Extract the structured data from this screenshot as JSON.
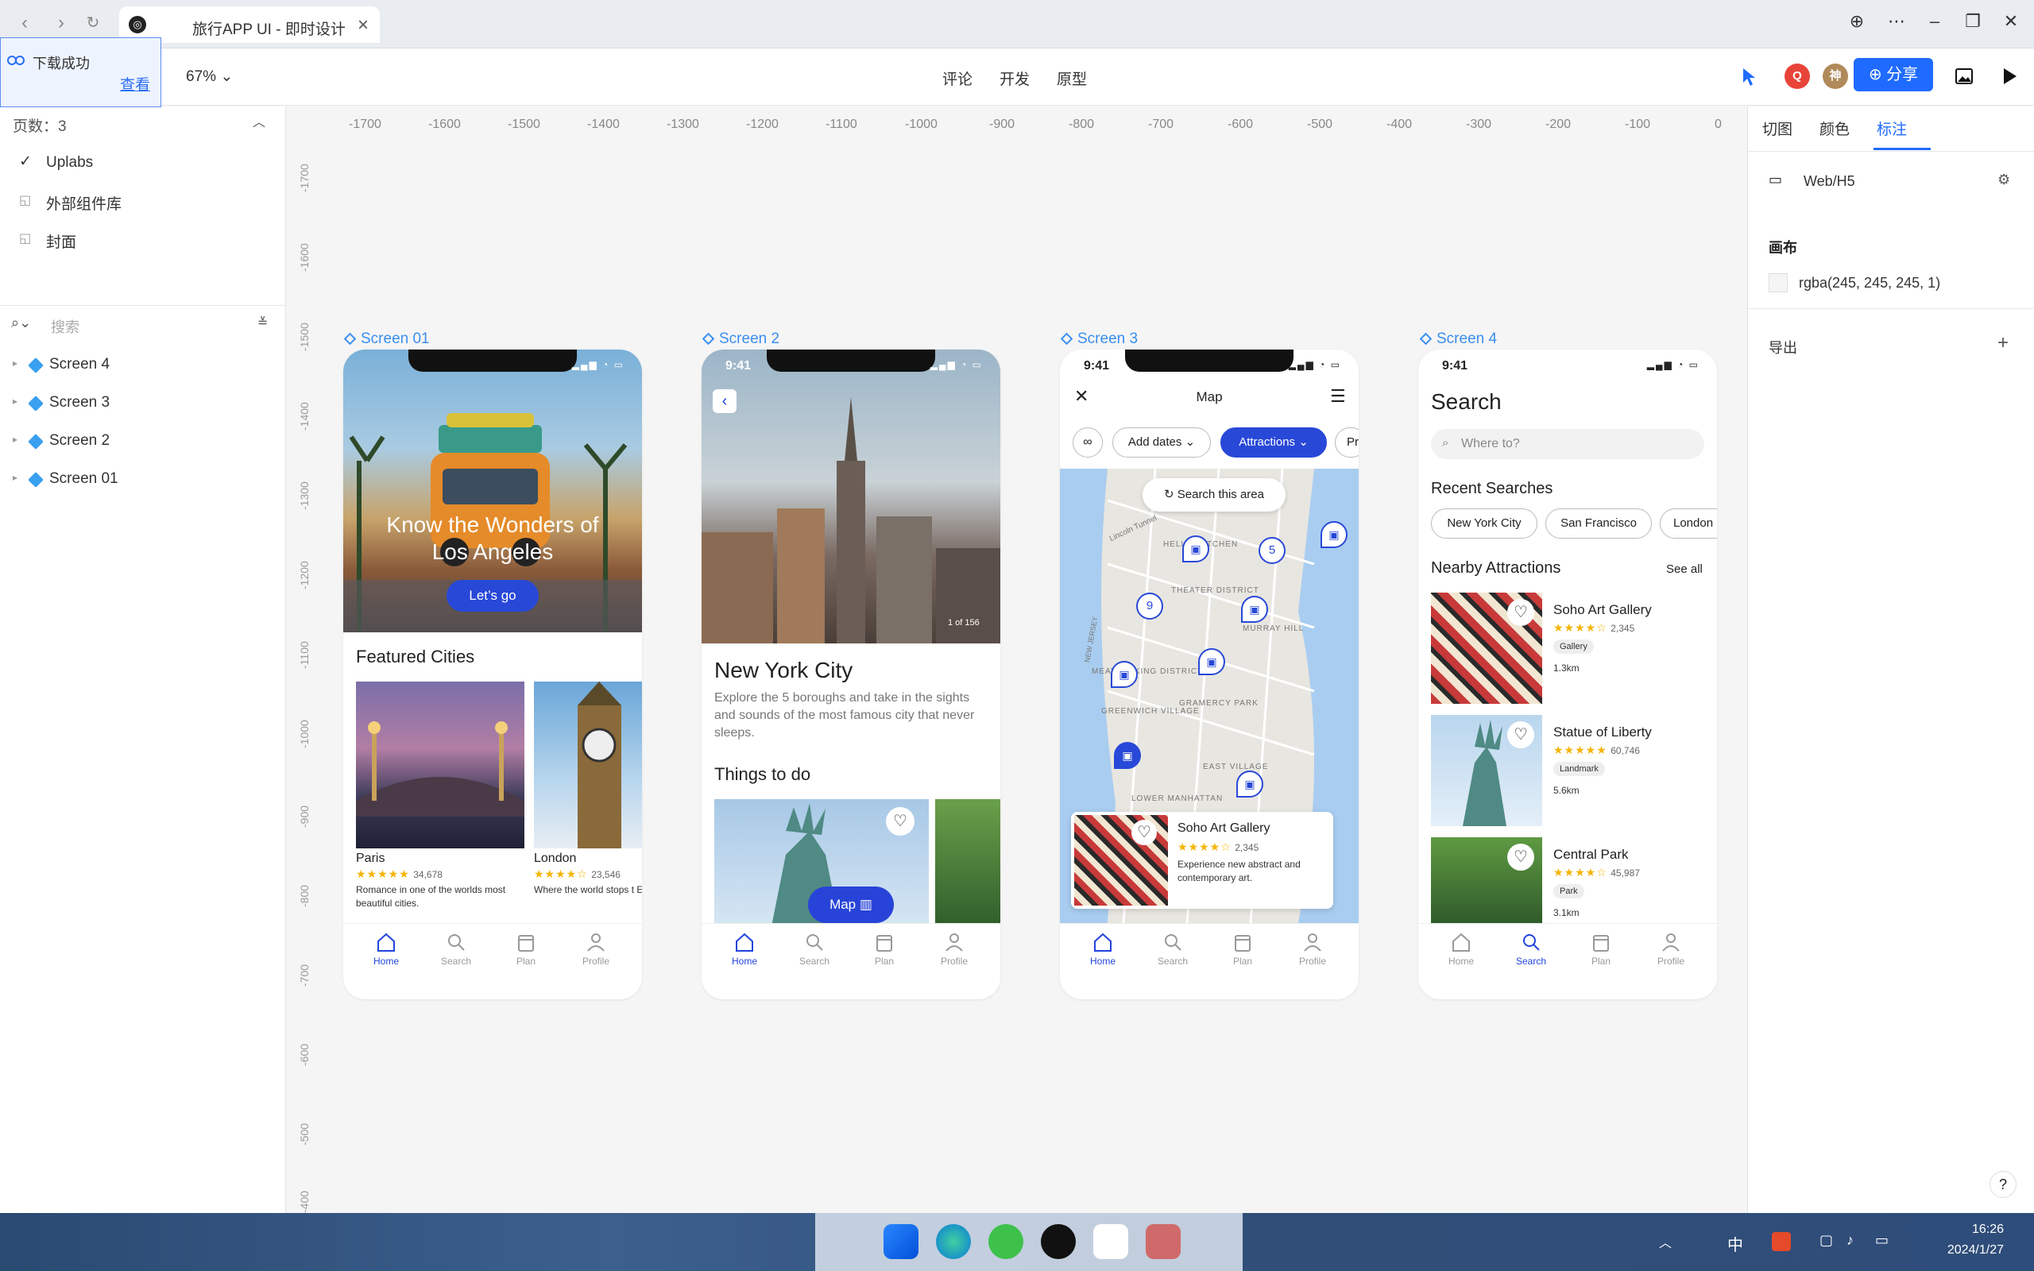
{
  "browser": {
    "tab_title": "旅行APP UI - 即时设计",
    "window_controls": [
      "globe",
      "more",
      "minimize",
      "restore",
      "close"
    ]
  },
  "toast": {
    "message": "下载成功",
    "link": "查看"
  },
  "toolbar": {
    "zoom": "67%",
    "tabs": [
      "评论",
      "开发",
      "原型"
    ],
    "avatars": [
      {
        "letter": "Q",
        "color": "#e8443a"
      },
      {
        "letter": "神",
        "color": "#b08a5a"
      }
    ],
    "share_label": "分享"
  },
  "left_panel": {
    "pages_label": "页数：3",
    "pages": [
      "Uplabs",
      "外部组件库",
      "封面"
    ],
    "search_placeholder": "搜索",
    "layers": [
      "Screen 4",
      "Screen 3",
      "Screen 2",
      "Screen 01"
    ]
  },
  "canvas": {
    "ruler_h": [
      "-1700",
      "-1600",
      "-1500",
      "-1400",
      "-1300",
      "-1200",
      "-1100",
      "-1000",
      "-900",
      "-800",
      "-700",
      "-600",
      "-500",
      "-400",
      "-300",
      "-200",
      "-100",
      "0"
    ],
    "ruler_v": [
      "-1700",
      "-1600",
      "-1500",
      "-1400",
      "-1300",
      "-1200",
      "-1100",
      "-1000",
      "-900",
      "-800",
      "-700",
      "-600",
      "-500",
      "-400"
    ],
    "screen_labels": [
      "Screen 01",
      "Screen 2",
      "Screen 3",
      "Screen 4"
    ]
  },
  "screen1": {
    "hero_title": "Know the Wonders of Los Angeles",
    "cta": "Let’s go",
    "section": "Featured Cities",
    "cities": [
      {
        "name": "Paris",
        "rating": "★★★★★",
        "count": "34,678",
        "desc": "Romance in one of the worlds most beautiful cities."
      },
      {
        "name": "London",
        "rating": "★★★★☆",
        "count": "23,546",
        "desc": "Where the world stops t England."
      }
    ]
  },
  "screen2": {
    "time": "9:41",
    "counter": "1 of 156",
    "title": "New York City",
    "desc": "Explore the 5 boroughs and take in the sights and sounds of the most famous city that never sleeps.",
    "section": "Things to do",
    "map_button": "Map"
  },
  "screen3": {
    "time": "9:41",
    "title": "Map",
    "filters": [
      "Add dates",
      "Attractions",
      "Pr"
    ],
    "search_area": "Search this area",
    "map_labels": [
      "HELL'S KITCHEN",
      "THEATER DISTRICT",
      "MURRAY HILL",
      "MEATPACKING DISTRICT",
      "GREENWICH VILLAGE",
      "GRAMERCY PARK",
      "EAST VILLAGE",
      "LOWER MANHATTAN",
      "Lincoln Tunnel",
      "NEW JERSEY"
    ],
    "clusters": [
      "5",
      "9"
    ],
    "card": {
      "name": "Soho Art Gallery",
      "rating": "★★★★☆",
      "count": "2,345",
      "desc": "Experience new abstract and contemporary art."
    }
  },
  "screen4": {
    "time": "9:41",
    "title": "Search",
    "search_placeholder": "Where to?",
    "recent_label": "Recent Searches",
    "recent": [
      "New York City",
      "San Francisco",
      "London"
    ],
    "nearby_label": "Nearby Attractions",
    "see_all": "See all",
    "attractions": [
      {
        "name": "Soho Art Gallery",
        "rating": "★★★★☆",
        "count": "2,345",
        "tag": "Gallery",
        "dist": "1.3km"
      },
      {
        "name": "Statue of Liberty",
        "rating": "★★★★★",
        "count": "60,746",
        "tag": "Landmark",
        "dist": "5.6km"
      },
      {
        "name": "Central Park",
        "rating": "★★★★☆",
        "count": "45,987",
        "tag": "Park",
        "dist": "3.1km"
      }
    ]
  },
  "bottom_nav": [
    "Home",
    "Search",
    "Plan",
    "Profile"
  ],
  "right_panel": {
    "tabs": [
      "切图",
      "颜色",
      "标注"
    ],
    "device": "Web/H5",
    "canvas_label": "画布",
    "canvas_color": "rgba(245, 245, 245, 1)",
    "export_label": "导出",
    "help": "?"
  },
  "taskbar": {
    "tray": [
      "中"
    ],
    "clock_time": "16:26",
    "clock_date": "2024/1/27"
  },
  "colors": {
    "accent": "#1f6bff",
    "app_blue": "#2244dd",
    "star": "#f5b400"
  }
}
